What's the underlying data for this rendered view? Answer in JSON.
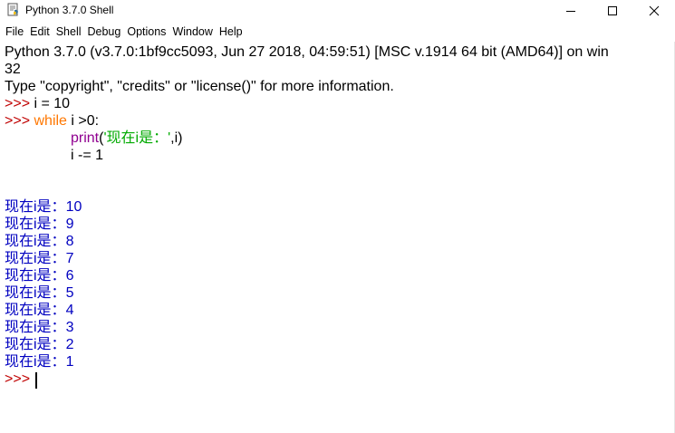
{
  "window": {
    "title": "Python 3.7.0 Shell",
    "icon": "python-idle-icon",
    "controls": [
      "minimize-icon",
      "maximize-icon",
      "close-icon"
    ]
  },
  "menu": [
    "File",
    "Edit",
    "Shell",
    "Debug",
    "Options",
    "Window",
    "Help"
  ],
  "shell": {
    "banner_line1": "Python 3.7.0 (v3.7.0:1bf9cc5093, Jun 27 2018, 04:59:51) [MSC v.1914 64 bit (AMD64)] on win",
    "banner_line2": "32",
    "banner_line3": "Type \"copyright\", \"credits\" or \"license()\" for more information.",
    "prompt": ">>> ",
    "cmd1": "i = 10",
    "kw_while": "while",
    "cmd2_rest": " i >0:",
    "builtin_print": "print",
    "paren_open": "(",
    "string_literal": "'现在i是：'",
    "print_rest": ",i)",
    "cmd3": "i -= 1",
    "output_prefix": "现在i是：",
    "outputs": [
      "10",
      "9",
      "8",
      "7",
      "6",
      "5",
      "4",
      "3",
      "2",
      "1"
    ],
    "final_prompt": ">>>"
  },
  "colors": {
    "prompt": "#c00000",
    "keyword": "#ff7700",
    "builtin": "#900090",
    "string": "#00aa00",
    "output": "#0000c0"
  }
}
